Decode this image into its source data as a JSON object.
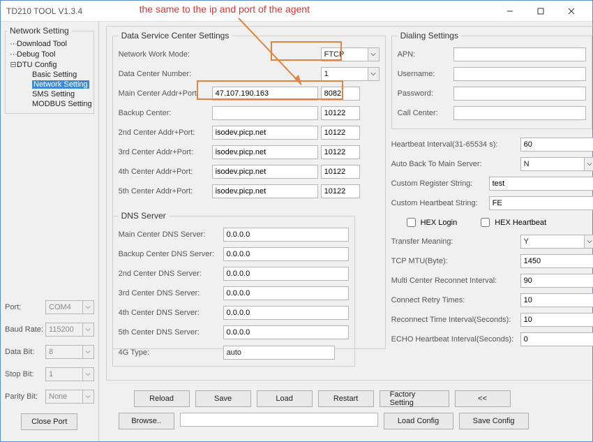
{
  "window": {
    "title": "TD210 TOOL V1.3.4"
  },
  "annotation": {
    "text": "the same to the ip and port of the agent"
  },
  "tree": {
    "root_label": "Network Setting",
    "items": [
      {
        "label": "Download Tool",
        "children": []
      },
      {
        "label": "Debug Tool",
        "children": []
      },
      {
        "label": "DTU Config",
        "children": [
          {
            "label": "Basic Setting"
          },
          {
            "label": "Network Setting",
            "selected": true
          },
          {
            "label": "SMS Setting"
          },
          {
            "label": "MODBUS Setting"
          }
        ]
      }
    ]
  },
  "port_panel": {
    "port_label": "Port:",
    "port_value": "COM4",
    "baud_label": "Baud Rate:",
    "baud_value": "115200",
    "data_label": "Data Bit:",
    "data_value": "8",
    "stop_label": "Stop Bit:",
    "stop_value": "1",
    "parity_label": "Parity Bit:",
    "parity_value": "None",
    "close_btn": "Close Port"
  },
  "dsc": {
    "legend": "Data Service Center Settings",
    "mode_label": "Network Work Mode:",
    "mode_value": "FTCP",
    "dcn_label": "Data Center Number:",
    "dcn_value": "1",
    "main_label": "Main Center Addr+Port:",
    "main_addr": "47.107.190.163",
    "main_port": "8082",
    "backup_label": "Backup Center:",
    "backup_addr": "",
    "backup_port": "10122",
    "c2_label": "2nd Center Addr+Port:",
    "c2_addr": "isodev.picp.net",
    "c2_port": "10122",
    "c3_label": "3rd Center Addr+Port:",
    "c3_addr": "isodev.picp.net",
    "c3_port": "10122",
    "c4_label": "4th Center Addr+Port:",
    "c4_addr": "isodev.picp.net",
    "c4_port": "10122",
    "c5_label": "5th Center Addr+Port:",
    "c5_addr": "isodev.picp.net",
    "c5_port": "10122"
  },
  "dns": {
    "legend": "DNS Server",
    "main_label": "Main Center DNS Server:",
    "main": "0.0.0.0",
    "backup_label": "Backup Center DNS Server:",
    "backup": "0.0.0.0",
    "s2_label": "2nd Center DNS Server:",
    "s2": "0.0.0.0",
    "s3_label": "3rd Center DNS Server:",
    "s3": "0.0.0.0",
    "s4_label": "4th Center DNS Server:",
    "s4": "0.0.0.0",
    "s5_label": "5th Center DNS Server:",
    "s5": "0.0.0.0",
    "fourg_label": "4G Type:",
    "fourg_value": "auto"
  },
  "dial": {
    "legend": "Dialing Settings",
    "apn_label": "APN:",
    "apn": "",
    "user_label": "Username:",
    "user": "",
    "pass_label": "Password:",
    "pass": "",
    "call_label": "Call Center:",
    "call": ""
  },
  "opts": {
    "hb_label": "Heartbeat Interval(31-65534 s):",
    "hb": "60",
    "autoback_label": "Auto Back To Main Server:",
    "autoback": "N",
    "reg_label": "Custom Register String:",
    "reg": "test",
    "chb_label": "Custom Heartbeat String:",
    "chb": "FE",
    "hexlogin_label": "HEX Login",
    "hexhb_label": "HEX Heartbeat",
    "tm_label": "Transfer Meaning:",
    "tm": "Y",
    "mtu_label": "TCP MTU(Byte):",
    "mtu": "1450",
    "mcr_label": "Multi Center Reconnet Interval:",
    "mcr": "90",
    "crt_label": "Connect Retry Times:",
    "crt": "10",
    "rti_label": "Reconnect Time Interval(Seconds):",
    "rti": "10",
    "echo_label": "ECHO Heartbeat Interval(Seconds):",
    "echo": "0"
  },
  "buttons": {
    "reload": "Reload",
    "save": "Save",
    "load": "Load",
    "restart": "Restart",
    "factory": "Factory Setting",
    "back": "<<",
    "browse": "Browse..",
    "loadcfg": "Load Config",
    "savecfg": "Save Config"
  }
}
